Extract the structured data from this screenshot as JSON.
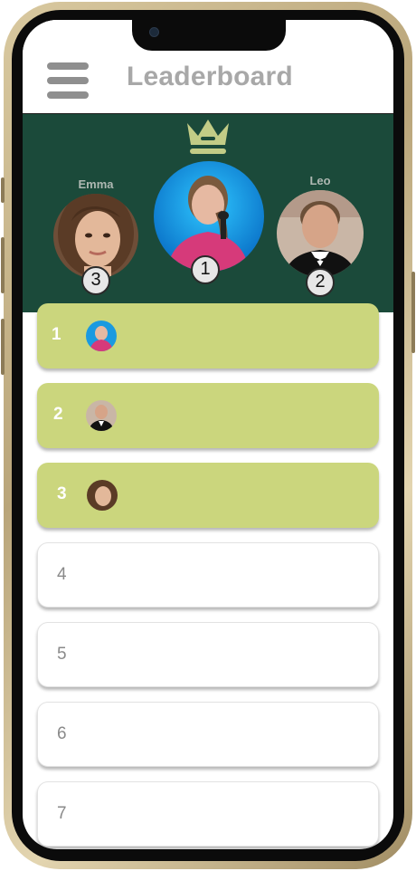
{
  "header": {
    "title": "Leaderboard",
    "menu_icon": "hamburger-menu-icon"
  },
  "podium": {
    "crown_icon": "crown-icon",
    "first": {
      "name": "",
      "rank": "1"
    },
    "second": {
      "name": "Leo",
      "rank": "2"
    },
    "third": {
      "name": "Emma",
      "rank": "3"
    }
  },
  "rows": [
    {
      "rank": "1"
    },
    {
      "rank": "2"
    },
    {
      "rank": "3"
    },
    {
      "rank": "4"
    },
    {
      "rank": "5"
    },
    {
      "rank": "6"
    },
    {
      "rank": "7"
    }
  ],
  "colors": {
    "podium_bg": "#1b4a3a",
    "top_card": "#cbd67d",
    "crown": "#c2cc86",
    "title": "#a8a8a8"
  }
}
